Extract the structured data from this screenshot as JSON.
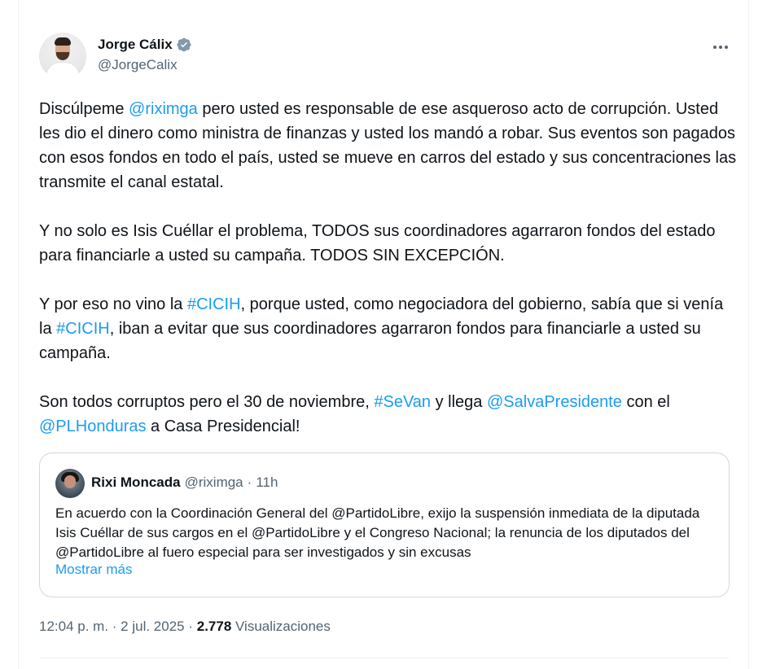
{
  "author": {
    "name": "Jorge Cálix",
    "handle": "@JorgeCalix",
    "verified_color": "#1d9bf0"
  },
  "tweet": {
    "p1_a": "Discúlpeme ",
    "p1_mention": "@riximga",
    "p1_b": " pero usted es responsable de ese asqueroso acto de corrupción. Usted les dio el dinero como ministra de finanzas y usted los mandó a robar. Sus eventos son pagados con esos fondos en todo el país, usted se mueve en carros del estado y sus concentraciones las transmite el canal estatal.",
    "p2": "Y no solo es Isis Cuéllar el problema, TODOS sus coordinadores agarraron fondos del estado para financiarle a usted su campaña. TODOS SIN EXCEPCIÓN.",
    "p3_a": "Y por eso no vino la ",
    "p3_hashtag1": "#CICIH",
    "p3_b": ", porque usted, como negociadora del gobierno, sabía que si venía la ",
    "p3_hashtag2": "#CICIH",
    "p3_c": ", iban a evitar que sus coordinadores agarraron fondos para financiarle a usted su campaña.",
    "p4_a": "Son todos corruptos pero el 30 de noviembre, ",
    "p4_hashtag": "#SeVan",
    "p4_b": " y llega ",
    "p4_mention1": "@SalvaPresidente",
    "p4_c": " con el ",
    "p4_mention2": "@PLHonduras",
    "p4_d": " a Casa Presidencial!"
  },
  "quote": {
    "name": "Rixi Moncada",
    "handle": "@riximga",
    "separator": "·",
    "time": "11h",
    "text": "En acuerdo con la Coordinación General del @PartidoLibre, exijo la suspensión inmediata de la diputada Isis Cuéllar de sus cargos en el @PartidoLibre y el Congreso Nacional; la renuncia de los diputados del @PartidoLibre al fuero especial para ser investigados y sin excusas",
    "show_more": "Mostrar más"
  },
  "meta": {
    "time": "12:04 p. m.",
    "sep1": " · ",
    "date": "2 jul. 2025",
    "sep2": " · ",
    "views_count": "2.778",
    "views_label": " Visualizaciones"
  },
  "colors": {
    "link": "#1d9bf0",
    "text": "#0f1419",
    "secondary": "#536471"
  }
}
